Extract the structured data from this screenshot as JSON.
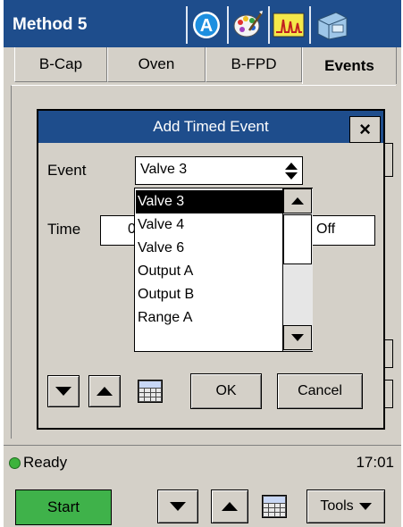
{
  "app": {
    "title": "Method 5",
    "title_icons": [
      "a-circle-icon",
      "palette-icon",
      "signal-chart-icon",
      "instrument-icon"
    ]
  },
  "tabs": [
    {
      "label": "B-Cap",
      "active": false
    },
    {
      "label": "Oven",
      "active": false
    },
    {
      "label": "B-FPD",
      "active": false
    },
    {
      "label": "Events",
      "active": true
    }
  ],
  "dialog": {
    "title": "Add Timed Event",
    "close_label": "×",
    "event_label": "Event",
    "event_value": "Valve 3",
    "time_label": "Time",
    "time_value": "0",
    "state_value": "Off",
    "options": [
      "Valve 3",
      "Valve 4",
      "Valve 6",
      "Output A",
      "Output B",
      "Range A"
    ],
    "selected_option": "Valve 3",
    "ok_label": "OK",
    "cancel_label": "Cancel"
  },
  "status": {
    "text": "Ready",
    "time": "17:01"
  },
  "toolbar": {
    "start_label": "Start",
    "tools_label": "Tools"
  },
  "colors": {
    "title_bar": "#1e4d8c",
    "start_button": "#3fb24a",
    "status_ready": "#3cb33c",
    "selection": "#000000"
  }
}
